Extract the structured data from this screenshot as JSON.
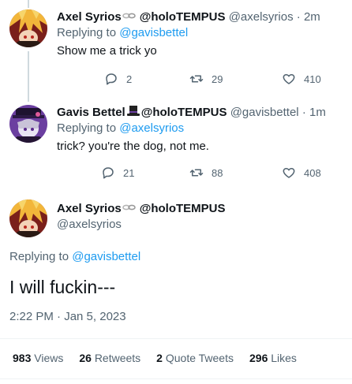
{
  "tweets": [
    {
      "name": "Axel Syrios",
      "affiliation": "@holoTEMPUS",
      "handle": "@axelsyrios",
      "separator": "·",
      "time": "2m",
      "replying_prefix": "Replying to",
      "replying_to": "@gavisbettel",
      "text": "Show me a trick yo",
      "replies": "2",
      "retweets": "29",
      "likes": "410"
    },
    {
      "name": "Gavis Bettel",
      "affiliation": "@holoTEMPUS",
      "handle": "@gavisbettel",
      "separator": "·",
      "time": "1m",
      "replying_prefix": "Replying to",
      "replying_to": "@axelsyrios",
      "text": "trick? you're the dog, not me.",
      "replies": "21",
      "retweets": "88",
      "likes": "408"
    }
  ],
  "main_tweet": {
    "name": "Axel Syrios",
    "affiliation": "@holoTEMPUS",
    "handle": "@axelsyrios",
    "replying_prefix": "Replying to",
    "replying_to": "@gavisbettel",
    "text": "I will fuckin---",
    "timestamp": "2:22 PM · Jan 5, 2023",
    "stats": [
      {
        "num": "983",
        "label": "Views"
      },
      {
        "num": "26",
        "label": "Retweets"
      },
      {
        "num": "2",
        "label": "Quote Tweets"
      },
      {
        "num": "296",
        "label": "Likes"
      }
    ]
  },
  "colors": {
    "link": "#1d9bf0",
    "muted": "#536471",
    "text": "#0f1419"
  },
  "icons": [
    "reply-icon",
    "retweet-icon",
    "like-icon",
    "chain-icon",
    "top-hat-icon"
  ]
}
